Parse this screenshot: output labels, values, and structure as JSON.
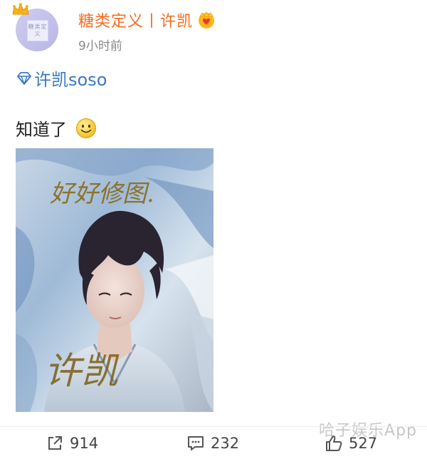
{
  "header": {
    "username": "糖类定义丨许凯",
    "time": "9小时前",
    "avatar_text": "糖类定义"
  },
  "post": {
    "mention": "许凯soso",
    "text": "知道了",
    "photo_signature_top": "好好修图.",
    "photo_signature_name": "许凯"
  },
  "actions": {
    "share_count": "914",
    "comment_count": "232",
    "like_count": "527"
  },
  "watermark": "哈子娱乐App",
  "colors": {
    "username": "#f46d20",
    "mention": "#3a78c2",
    "time": "#888888"
  },
  "icons": [
    "crown-icon",
    "vip-heart-icon",
    "diamond-icon",
    "smile-emoji-icon",
    "share-icon",
    "comment-icon",
    "like-icon"
  ]
}
